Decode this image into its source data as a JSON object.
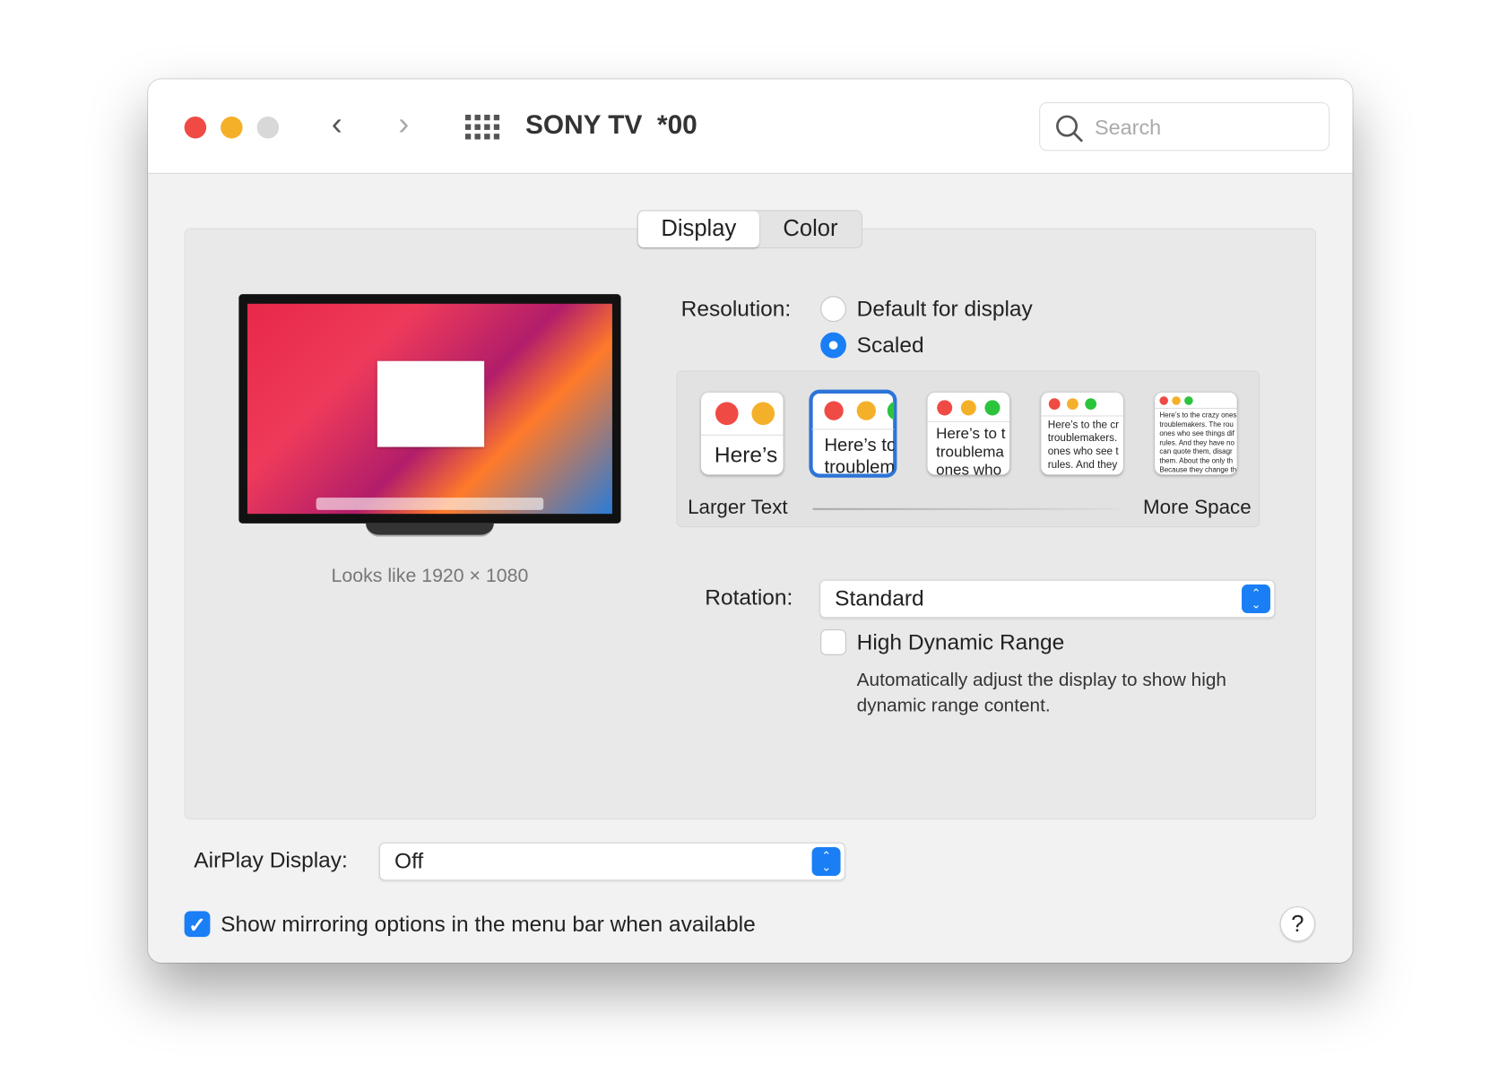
{
  "window": {
    "title": "SONY TV  *00",
    "search_placeholder": "Search"
  },
  "tabs": [
    {
      "label": "Display",
      "selected": true
    },
    {
      "label": "Color",
      "selected": false
    }
  ],
  "display": {
    "looks_like": "Looks like 1920 × 1080",
    "resolution_label": "Resolution:",
    "resolution_options": [
      {
        "label": "Default for display",
        "selected": false
      },
      {
        "label": "Scaled",
        "selected": true
      }
    ],
    "scale_left": "Larger Text",
    "scale_right": "More Space",
    "scale_thumbs": [
      "Here’s",
      "Here’s to\ntroublem",
      "Here’s to t\ntroublema\nones who",
      "Here’s to the cr\ntroublemakers.\nones who see t\nrules. And they",
      "Here’s to the crazy ones\ntroublemakers. The rou\nones who see things dif\nrules. And they have no\ncan quote them, disagr\nthem. About the only th\nBecause they change th"
    ],
    "selected_scale_index": 1,
    "rotation_label": "Rotation:",
    "rotation_value": "Standard",
    "hdr_label": "High Dynamic Range",
    "hdr_checked": false,
    "hdr_desc": "Automatically adjust the display to show high dynamic range content."
  },
  "airplay": {
    "label": "AirPlay Display:",
    "value": "Off"
  },
  "mirroring": {
    "label": "Show mirroring options in the menu bar when available",
    "checked": true
  },
  "help": "?",
  "colors": {
    "accent": "#1a7ef5",
    "close": "#f04a45",
    "minimize": "#f5b02a",
    "zoom_disabled": "#d8d8d8"
  }
}
